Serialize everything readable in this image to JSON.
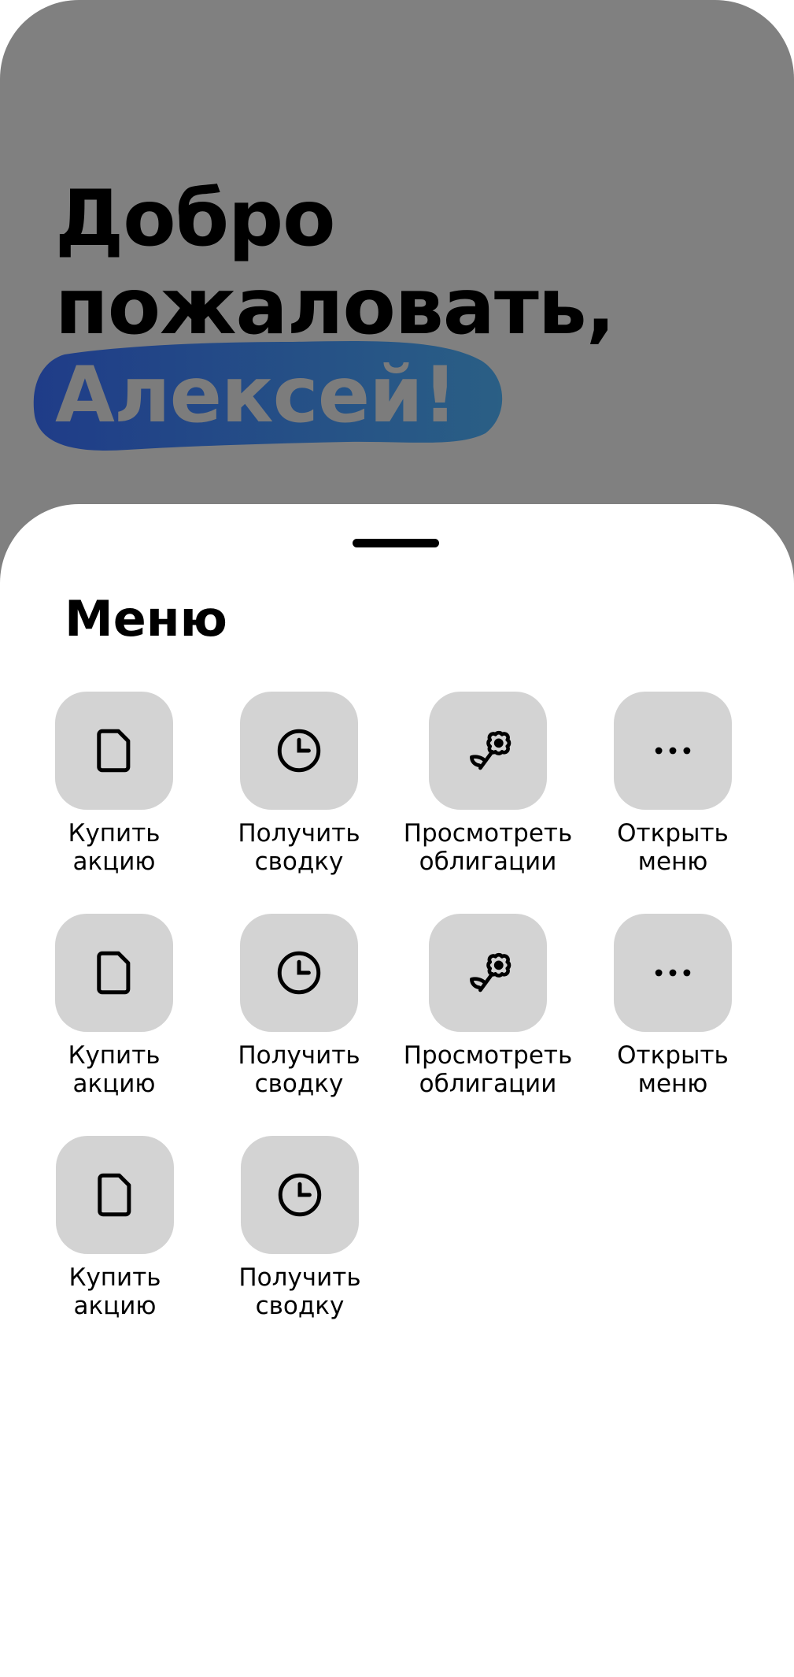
{
  "hero": {
    "greeting_line1": "Добро",
    "greeting_line2": "пожаловать,",
    "user_name": "Алексей!",
    "background_color": "#808080",
    "highlight_color_start": "#1f3c88",
    "highlight_color_end": "#2a5f85"
  },
  "menu": {
    "title": "Меню",
    "tile_color": "#d3d3d3",
    "rows": [
      [
        {
          "icon": "document-icon",
          "label_line1": "Купить",
          "label_line2": "акцию"
        },
        {
          "icon": "clock-icon",
          "label_line1": "Получить",
          "label_line2": "сводку"
        },
        {
          "icon": "flower-icon",
          "label_line1": "Просмотреть",
          "label_line2": "облигации"
        },
        {
          "icon": "more-horizontal-icon",
          "label_line1": "Открыть",
          "label_line2": "меню"
        }
      ],
      [
        {
          "icon": "document-icon",
          "label_line1": "Купить",
          "label_line2": "акцию"
        },
        {
          "icon": "clock-icon",
          "label_line1": "Получить",
          "label_line2": "сводку"
        },
        {
          "icon": "flower-icon",
          "label_line1": "Просмотреть",
          "label_line2": "облигации"
        },
        {
          "icon": "more-horizontal-icon",
          "label_line1": "Открыть",
          "label_line2": "меню"
        }
      ],
      [
        {
          "icon": "document-icon",
          "label_line1": "Купить",
          "label_line2": "акцию"
        },
        {
          "icon": "clock-icon",
          "label_line1": "Получить",
          "label_line2": "сводку"
        }
      ]
    ]
  }
}
